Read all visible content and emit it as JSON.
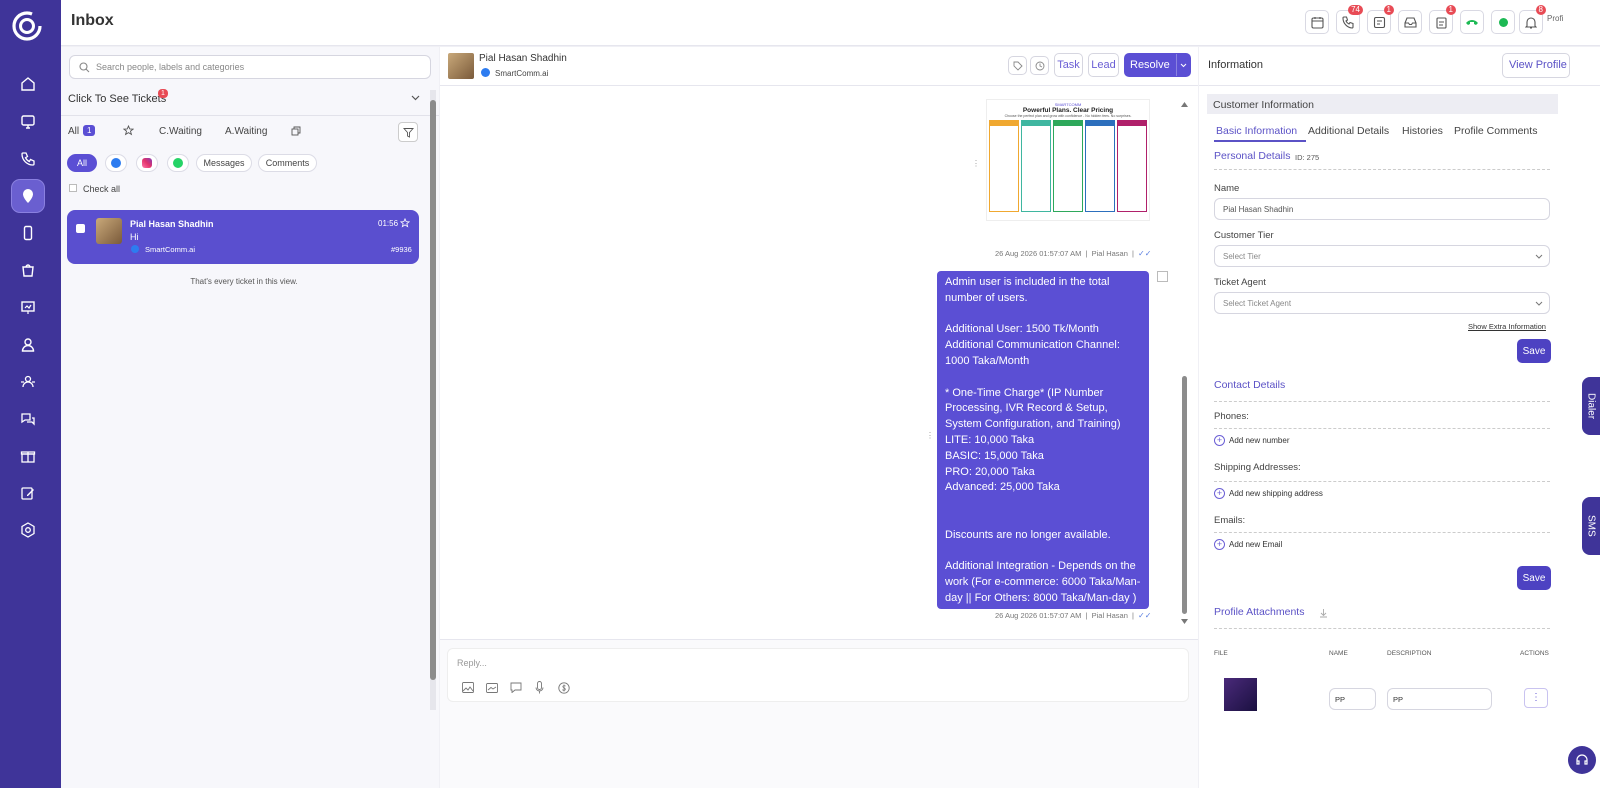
{
  "header": {
    "title": "Inbox"
  },
  "topbar_badges": {
    "calls": "74",
    "notes": "1",
    "tasks": "1",
    "notifications": "8"
  },
  "profile_alt": "Profile",
  "search": {
    "placeholder": "Search people, labels and categories"
  },
  "tickets_toggle": {
    "label": "Click To See Tickets",
    "badge": "1"
  },
  "filter_tabs": {
    "all": "All",
    "all_count": "1",
    "c_waiting": "C.Waiting",
    "a_waiting": "A.Waiting"
  },
  "channel_chips": {
    "all": "All",
    "messages": "Messages",
    "comments": "Comments"
  },
  "check_all": "Check all",
  "ticket": {
    "name": "Pial Hasan Shadhin",
    "time": "01:56",
    "preview": "Hi",
    "source": "SmartComm.ai",
    "number": "#9936"
  },
  "end_of_list": "That's every ticket in this view.",
  "chat": {
    "contact_name": "Pial Hasan Shadhin",
    "contact_source": "SmartComm.ai",
    "buttons": {
      "task": "Task",
      "lead": "Lead",
      "resolve": "Resolve"
    },
    "image_msg": {
      "brand": "SMARTCOMM",
      "heading": "Powerful Plans. Clear Pricing",
      "subheading": "Choose the perfect plan and grow with confidence - No hidden fees. No surprises.",
      "plans": [
        "Lite",
        "Basic",
        "Pro",
        "Advanced",
        "Custom"
      ],
      "meta": "26 Aug 2026 01:57:07 AM  |  Pial Hasan  |"
    },
    "text_msg": {
      "body": "Admin user is included in the total number of users.\n\nAdditional User: 1500 Tk/Month\nAdditional Communication Channel: 1000 Taka/Month\n\n* One-Time Charge* (IP Number Processing, IVR Record & Setup, System Configuration, and Training)\nLITE: 10,000 Taka\nBASIC: 15,000 Taka\nPRO: 20,000 Taka\nAdvanced: 25,000 Taka\n\n\nDiscounts are no longer available.\n\nAdditional Integration - Depends on the work (For e-commerce: 6000 Taka/Man-day || For Others: 8000 Taka/Man-day )",
      "meta": "26 Aug 2026 01:57:07 AM  |  Pial Hasan  |"
    },
    "reply_placeholder": "Reply..."
  },
  "info": {
    "title": "Information",
    "view_profile": "View Profile",
    "customer_info": "Customer Information",
    "tabs": [
      "Basic Information",
      "Additional Details",
      "Histories",
      "Profile Comments"
    ],
    "personal_details": "Personal Details",
    "id_label": "ID: 275",
    "name_label": "Name",
    "name_value": "Pial Hasan Shadhin",
    "tier_label": "Customer Tier",
    "tier_placeholder": "Select Tier",
    "agent_label": "Ticket Agent",
    "agent_placeholder": "Select Ticket Agent",
    "show_extra": "Show Extra Information",
    "save": "Save",
    "contact_details": "Contact Details",
    "phones": "Phones:",
    "add_number": "Add new number",
    "shipping": "Shipping Addresses:",
    "add_shipping": "Add new shipping address",
    "emails": "Emails:",
    "add_email": "Add new Email",
    "attachments": "Profile Attachments",
    "cols": {
      "file": "FILE",
      "name": "NAME",
      "description": "DESCRIPTION",
      "actions": "ACTIONS"
    },
    "attachment": {
      "name": "PP",
      "description": "PP"
    },
    "dialer_tab": "Dialer",
    "sms_tab": "SMS"
  },
  "colors": {
    "brand": "#3f3499",
    "accent": "#5b4fd4",
    "badge": "#e84b55",
    "online": "#1db954"
  }
}
